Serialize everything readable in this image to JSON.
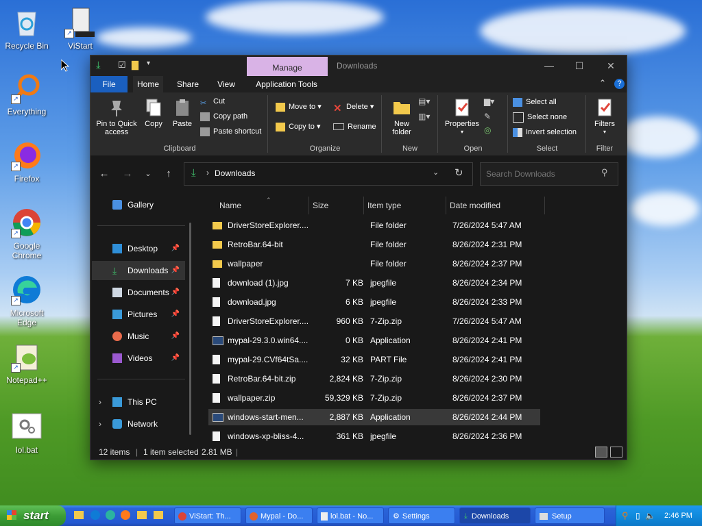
{
  "desktop": {
    "icons": [
      {
        "label": "Recycle Bin"
      },
      {
        "label": "ViStart"
      },
      {
        "label": "Everything"
      },
      {
        "label": "Firefox"
      },
      {
        "label": "Google Chrome"
      },
      {
        "label": "Microsoft Edge"
      },
      {
        "label": "Notepad++"
      },
      {
        "label": "lol.bat"
      }
    ]
  },
  "window": {
    "title": "Downloads",
    "context_tab": "Manage",
    "menu_tabs": {
      "file": "File",
      "home": "Home",
      "share": "Share",
      "view": "View",
      "app_tools": "Application Tools"
    },
    "ribbon": {
      "clipboard": {
        "label": "Clipboard",
        "pin": "Pin to Quick access",
        "copy": "Copy",
        "paste": "Paste",
        "cut": "Cut",
        "copy_path": "Copy path",
        "paste_shortcut": "Paste shortcut"
      },
      "organize": {
        "label": "Organize",
        "move_to": "Move to",
        "copy_to": "Copy to",
        "delete": "Delete",
        "rename": "Rename"
      },
      "new": {
        "label": "New",
        "new_folder": "New folder"
      },
      "open": {
        "label": "Open",
        "properties": "Properties"
      },
      "select": {
        "label": "Select",
        "select_all": "Select all",
        "select_none": "Select none",
        "invert": "Invert selection"
      },
      "filter": {
        "label": "Filter",
        "filters": "Filters"
      }
    },
    "address": {
      "path": "Downloads",
      "search_placeholder": "Search Downloads"
    },
    "nav": [
      {
        "label": "Gallery"
      },
      {
        "label": "Desktop"
      },
      {
        "label": "Downloads"
      },
      {
        "label": "Documents"
      },
      {
        "label": "Pictures"
      },
      {
        "label": "Music"
      },
      {
        "label": "Videos"
      },
      {
        "label": "This PC"
      },
      {
        "label": "Network"
      }
    ],
    "columns": {
      "name": "Name",
      "size": "Size",
      "type": "Item type",
      "date": "Date modified"
    },
    "files": [
      {
        "name": "DriverStoreExplorer....",
        "size": "",
        "type": "File folder",
        "date": "7/26/2024 5:47 AM"
      },
      {
        "name": "RetroBar.64-bit",
        "size": "",
        "type": "File folder",
        "date": "8/26/2024 2:31 PM"
      },
      {
        "name": "wallpaper",
        "size": "",
        "type": "File folder",
        "date": "8/26/2024 2:37 PM"
      },
      {
        "name": "download (1).jpg",
        "size": "7 KB",
        "type": "jpegfile",
        "date": "8/26/2024 2:34 PM"
      },
      {
        "name": "download.jpg",
        "size": "6 KB",
        "type": "jpegfile",
        "date": "8/26/2024 2:33 PM"
      },
      {
        "name": "DriverStoreExplorer....",
        "size": "960 KB",
        "type": "7-Zip.zip",
        "date": "7/26/2024 5:47 AM"
      },
      {
        "name": "mypal-29.3.0.win64....",
        "size": "0 KB",
        "type": "Application",
        "date": "8/26/2024 2:41 PM"
      },
      {
        "name": "mypal-29.CVf64tSa....",
        "size": "32 KB",
        "type": "PART File",
        "date": "8/26/2024 2:41 PM"
      },
      {
        "name": "RetroBar.64-bit.zip",
        "size": "2,824 KB",
        "type": "7-Zip.zip",
        "date": "8/26/2024 2:30 PM"
      },
      {
        "name": "wallpaper.zip",
        "size": "59,329 KB",
        "type": "7-Zip.zip",
        "date": "8/26/2024 2:37 PM"
      },
      {
        "name": "windows-start-men...",
        "size": "2,887 KB",
        "type": "Application",
        "date": "8/26/2024 2:44 PM"
      },
      {
        "name": "windows-xp-bliss-4...",
        "size": "361 KB",
        "type": "jpegfile",
        "date": "8/26/2024 2:36 PM"
      }
    ],
    "status": {
      "count": "12 items",
      "selected": "1 item selected",
      "size": "2.81 MB"
    }
  },
  "taskbar": {
    "start": "start",
    "buttons": [
      {
        "label": "ViStart: Th..."
      },
      {
        "label": "Mypal - Do..."
      },
      {
        "label": "lol.bat - No..."
      },
      {
        "label": "Settings"
      },
      {
        "label": "Downloads"
      },
      {
        "label": "Setup"
      }
    ],
    "clock": "2:46 PM"
  },
  "colors": {
    "accent": "#1a5fbf",
    "manage_tab": "#d9b3e6",
    "selection": "#393939"
  }
}
